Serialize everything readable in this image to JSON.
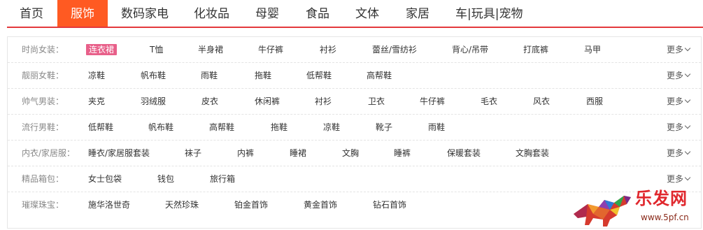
{
  "nav": {
    "items": [
      "首页",
      "服饰",
      "数码家电",
      "化妆品",
      "母婴",
      "食品",
      "文体",
      "家居",
      "车|玩具|宠物"
    ],
    "active_index": 1,
    "active_color": "#ff5a22",
    "border_color": "#e4393c"
  },
  "categories": [
    {
      "label": "时尚女装：",
      "links": [
        "连衣裙",
        "T恤",
        "半身裙",
        "牛仔裤",
        "衬衫",
        "蕾丝/雪纺衫",
        "背心/吊带",
        "打底裤",
        "马甲"
      ],
      "highlight_index": 0
    },
    {
      "label": "靓丽女鞋：",
      "links": [
        "凉鞋",
        "帆布鞋",
        "雨鞋",
        "拖鞋",
        "低帮鞋",
        "高帮鞋"
      ]
    },
    {
      "label": "帅气男装：",
      "links": [
        "夹克",
        "羽绒服",
        "皮衣",
        "休闲裤",
        "衬衫",
        "卫衣",
        "牛仔裤",
        "毛衣",
        "风衣",
        "西服"
      ]
    },
    {
      "label": "流行男鞋：",
      "links": [
        "低帮鞋",
        "帆布鞋",
        "高帮鞋",
        "拖鞋",
        "凉鞋",
        "靴子",
        "雨鞋"
      ]
    },
    {
      "label": "内衣/家居服：",
      "links": [
        "睡衣/家居服套装",
        "袜子",
        "内裤",
        "睡裙",
        "文胸",
        "睡裤",
        "保暖套装",
        "文胸套装"
      ]
    },
    {
      "label": "精品箱包：",
      "links": [
        "女士包袋",
        "钱包",
        "旅行箱"
      ]
    },
    {
      "label": "璀璨珠宝：",
      "links": [
        "施华洛世奇",
        "天然珍珠",
        "铂金首饰",
        "黄金首饰",
        "钻石首饰"
      ]
    }
  ],
  "more_label": "更多",
  "highlight_color": "#e8608a",
  "watermark": {
    "text": "乐发网",
    "url": "www.5pf.cn"
  }
}
